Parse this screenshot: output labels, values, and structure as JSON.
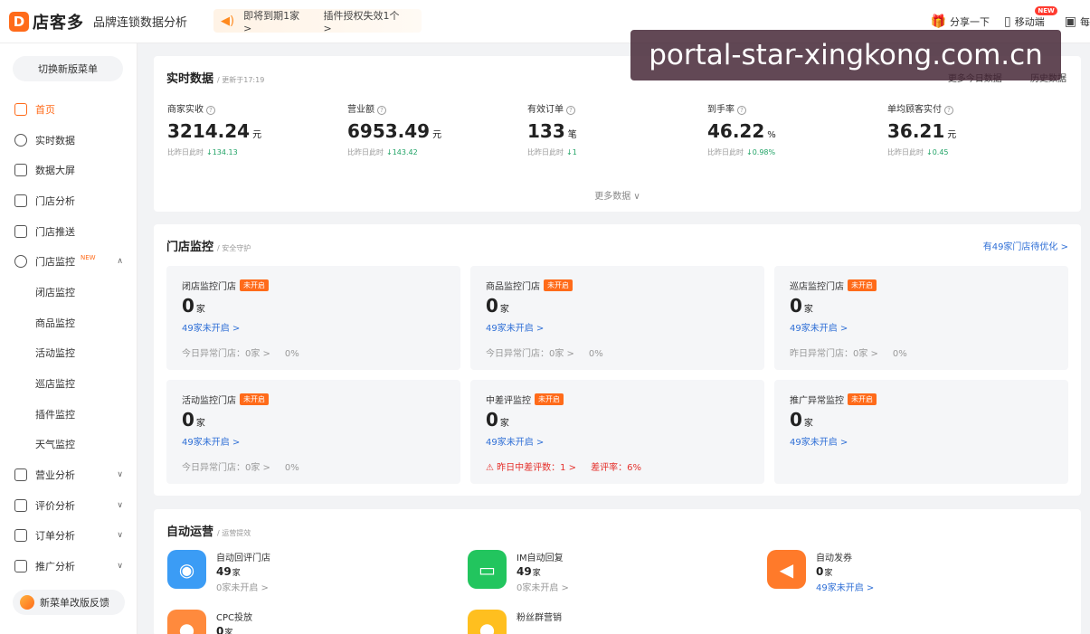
{
  "header": {
    "logo_mark": "D",
    "logo_text": "店客多",
    "app_title": "品牌连锁数据分析",
    "notices": [
      "即将到期1家 >",
      "插件授权失效1个 >"
    ],
    "share_label": "分享一下",
    "mobile_label": "移动端",
    "mobile_badge": "NEW",
    "calendar_label": "每"
  },
  "watermark": "portal-star-xingkong.com.cn",
  "sidebar": {
    "switch_label": "切换新版菜单",
    "items": [
      {
        "label": "首页"
      },
      {
        "label": "实时数据"
      },
      {
        "label": "数据大屏"
      },
      {
        "label": "门店分析"
      },
      {
        "label": "门店推送"
      },
      {
        "label": "门店监控",
        "tag": "NEW"
      },
      {
        "label": "闭店监控"
      },
      {
        "label": "商品监控"
      },
      {
        "label": "活动监控"
      },
      {
        "label": "巡店监控"
      },
      {
        "label": "插件监控"
      },
      {
        "label": "天气监控"
      },
      {
        "label": "营业分析"
      },
      {
        "label": "评价分析"
      },
      {
        "label": "订单分析"
      },
      {
        "label": "推广分析"
      }
    ],
    "feedback_label": "新菜单改版反馈"
  },
  "realtime": {
    "title": "实时数据",
    "updated": "/ 更新于17:19",
    "links": [
      "更多今日数据",
      "历史数据"
    ],
    "metrics": [
      {
        "label": "商家实收",
        "value": "3214.24",
        "unit": "元",
        "compare": "比昨日此时",
        "delta": "↓134.13"
      },
      {
        "label": "营业额",
        "value": "6953.49",
        "unit": "元",
        "compare": "比昨日此时",
        "delta": "↓143.42"
      },
      {
        "label": "有效订单",
        "value": "133",
        "unit": "笔",
        "compare": "比昨日此时",
        "delta": "↓1"
      },
      {
        "label": "到手率",
        "value": "46.22",
        "unit": "%",
        "compare": "比昨日此时",
        "delta": "↓0.98%"
      },
      {
        "label": "单均顾客实付",
        "value": "36.21",
        "unit": "元",
        "compare": "比昨日此时",
        "delta": "↓0.45"
      }
    ],
    "more": "更多数据 ∨"
  },
  "monitor": {
    "title": "门店监控",
    "sub": "/ 安全守护",
    "link": "有49家门店待优化 >",
    "cards": [
      {
        "title": "闭店监控门店",
        "tag": "未开启",
        "count": "0",
        "unit": "家",
        "not_open": "49家未开启 >",
        "foot": "今日异常门店：0家 >",
        "pct": "0%"
      },
      {
        "title": "商品监控门店",
        "tag": "未开启",
        "count": "0",
        "unit": "家",
        "not_open": "49家未开启 >",
        "foot": "今日异常门店：0家 >",
        "pct": "0%"
      },
      {
        "title": "巡店监控门店",
        "tag": "未开启",
        "count": "0",
        "unit": "家",
        "not_open": "49家未开启 >",
        "foot": "昨日异常门店：0家 >",
        "pct": "0%"
      },
      {
        "title": "活动监控门店",
        "tag": "未开启",
        "count": "0",
        "unit": "家",
        "not_open": "49家未开启 >",
        "foot": "今日异常门店：0家 >",
        "pct": "0%"
      },
      {
        "title": "中差评监控",
        "tag": "未开启",
        "count": "0",
        "unit": "家",
        "not_open": "49家未开启 >",
        "foot": "⚠ 昨日中差评数：1 >",
        "pct": "差评率：6%",
        "warn": true
      },
      {
        "title": "推广异常监控",
        "tag": "未开启",
        "count": "0",
        "unit": "家",
        "not_open": "49家未开启 >",
        "foot": "",
        "pct": ""
      }
    ]
  },
  "auto_ops": {
    "title": "自动运营",
    "sub": "/ 运营提效",
    "items": [
      {
        "name": "自动回评门店",
        "count": "49",
        "unit": "家",
        "not_open": "0家未开启 >",
        "color": "#3b9cf5"
      },
      {
        "name": "IM自动回复",
        "count": "49",
        "unit": "家",
        "not_open": "0家未开启 >",
        "color": "#22c55e"
      },
      {
        "name": "自动发券",
        "count": "0",
        "unit": "家",
        "not_open": "49家未开启 >",
        "color": "#ff7a2a"
      },
      {
        "name": "CPC投放",
        "count": "0",
        "unit": "家",
        "not_open": "",
        "color": "#ff8a3d"
      },
      {
        "name": "粉丝群营销",
        "count": "",
        "unit": "",
        "not_open": "",
        "color": "#ffbf1f"
      }
    ]
  }
}
